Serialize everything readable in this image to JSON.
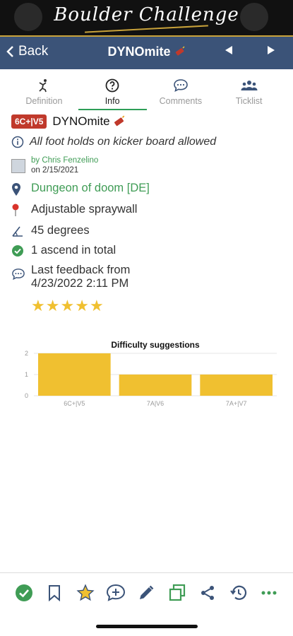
{
  "banner": {
    "logo_text": "Boulder Challenge"
  },
  "nav": {
    "back_label": "Back",
    "title": "DYNOmite",
    "title_icon": "dynamite-icon"
  },
  "tabs": [
    {
      "label": "Definition",
      "icon": "climber-icon",
      "active": false
    },
    {
      "label": "Info",
      "icon": "question-circle-icon",
      "active": true
    },
    {
      "label": "Comments",
      "icon": "speech-bubble-icon",
      "active": false
    },
    {
      "label": "Ticklist",
      "icon": "people-icon",
      "active": false
    }
  ],
  "route": {
    "grade": "6C+|V5",
    "name": "DYNOmite",
    "description": "All foot holds on kicker board allowed",
    "setter_by": "by Chris Fenzelino",
    "setter_on": "on 2/15/2021",
    "location": "Dungeon of doom [DE]",
    "wall": "Adjustable spraywall",
    "angle": "45 degrees",
    "ascends": "1 ascend in total",
    "feedback_label": "Last feedback from",
    "feedback_date": "4/23/2022 2:11 PM",
    "rating": 5
  },
  "colors": {
    "accent": "#3f9c55",
    "nav": "#3b5378",
    "grade": "#c0392b",
    "bar": "#f0c030"
  },
  "chart_data": {
    "type": "bar",
    "title": "Difficulty suggestions",
    "categories": [
      "6C+|V5",
      "7A|V6",
      "7A+|V7"
    ],
    "values": [
      2,
      1,
      1
    ],
    "ylim": [
      0,
      2
    ],
    "yticks": [
      0,
      1,
      2
    ],
    "grid": true
  },
  "toolbar": [
    "check-circle-icon",
    "bookmark-icon",
    "star-icon",
    "comment-add-icon",
    "pencil-icon",
    "copy-icon",
    "share-icon",
    "history-icon",
    "more-icon"
  ]
}
